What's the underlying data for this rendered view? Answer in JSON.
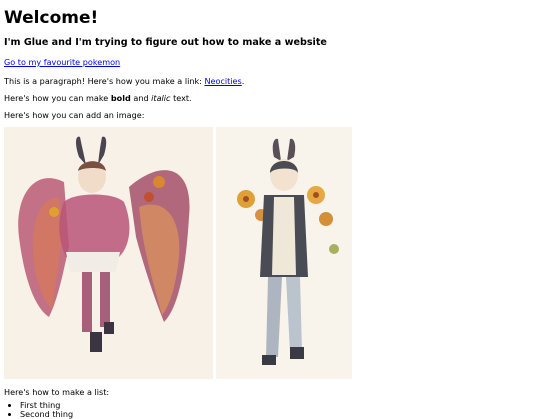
{
  "page": {
    "title": "Welcome!",
    "subtitle": "I'm Glue and I'm trying to figure out how to make a website",
    "favourite_link": "Go to my favourite pokemon",
    "paragraph1": {
      "before": "This is a paragraph! Here's how you make a link: ",
      "link": "Neocities",
      "after": "."
    },
    "paragraph2": {
      "before": "Here's how you can make ",
      "bold": "bold",
      "middle": " and ",
      "italic": "italic",
      "after": " text."
    },
    "paragraph3": "Here's how you can add an image:",
    "images": [
      {
        "description": "watercolor-winged-character"
      },
      {
        "description": "watercolor-character-with-flowers"
      }
    ],
    "list_intro": "Here's how to make a list:",
    "list_items": [
      "First thing",
      "Second thing"
    ],
    "colors": {
      "link": "#0000ee",
      "text": "#000000",
      "background": "#ffffff"
    }
  }
}
